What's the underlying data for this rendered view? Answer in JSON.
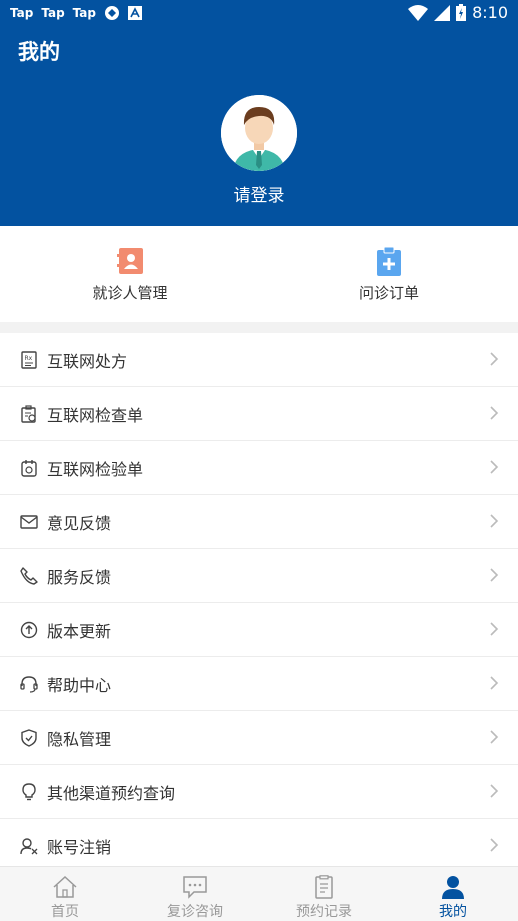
{
  "status_bar": {
    "apps": [
      "Tap",
      "Tap",
      "Tap"
    ],
    "time": "8:10"
  },
  "header": {
    "title": "我的",
    "login_label": "请登录"
  },
  "quick_actions": [
    {
      "label": "就诊人管理",
      "icon": "patient-card-icon",
      "color": "#f28b6f"
    },
    {
      "label": "问诊订单",
      "icon": "clipboard-plus-icon",
      "color": "#5aa6ef"
    }
  ],
  "menu": [
    {
      "label": "互联网处方",
      "icon": "prescription-icon"
    },
    {
      "label": "互联网检查单",
      "icon": "exam-form-icon"
    },
    {
      "label": "互联网检验单",
      "icon": "lab-test-icon"
    },
    {
      "label": "意见反馈",
      "icon": "mail-icon"
    },
    {
      "label": "服务反馈",
      "icon": "phone-icon"
    },
    {
      "label": "版本更新",
      "icon": "upload-icon"
    },
    {
      "label": "帮助中心",
      "icon": "headset-icon"
    },
    {
      "label": "隐私管理",
      "icon": "shield-icon"
    },
    {
      "label": "其他渠道预约查询",
      "icon": "bulb-icon"
    },
    {
      "label": "账号注销",
      "icon": "user-remove-icon"
    }
  ],
  "tabbar": [
    {
      "label": "首页",
      "icon": "home-icon",
      "active": false
    },
    {
      "label": "复诊咨询",
      "icon": "chat-icon",
      "active": false
    },
    {
      "label": "预约记录",
      "icon": "document-icon",
      "active": false
    },
    {
      "label": "我的",
      "icon": "user-icon",
      "active": true
    }
  ],
  "colors": {
    "primary": "#0352a0",
    "patient": "#f28b6f",
    "order": "#5aa6ef"
  }
}
